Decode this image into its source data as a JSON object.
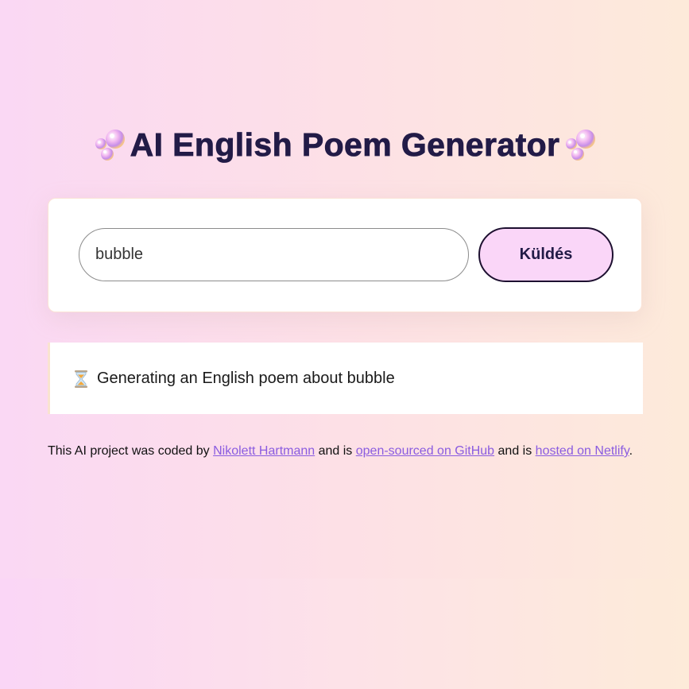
{
  "header": {
    "title": "AI English Poem Generator",
    "icon": "bubbles-icon"
  },
  "form": {
    "input_value": "bubble",
    "submit_label": "Küldés"
  },
  "poem": {
    "status_icon": "hourglass-icon",
    "status_text": "Generating an English poem about bubble"
  },
  "footer": {
    "text_1": "This AI project was coded by ",
    "author_link": "Nikolett Hartmann",
    "text_2": " and is ",
    "github_link": "open-sourced on GitHub",
    "text_3": " and is ",
    "netlify_link": "hosted on Netlify",
    "text_4": "."
  },
  "colors": {
    "title": "#221b47",
    "button_bg": "#fad6f8",
    "link": "#8a5ce0"
  }
}
